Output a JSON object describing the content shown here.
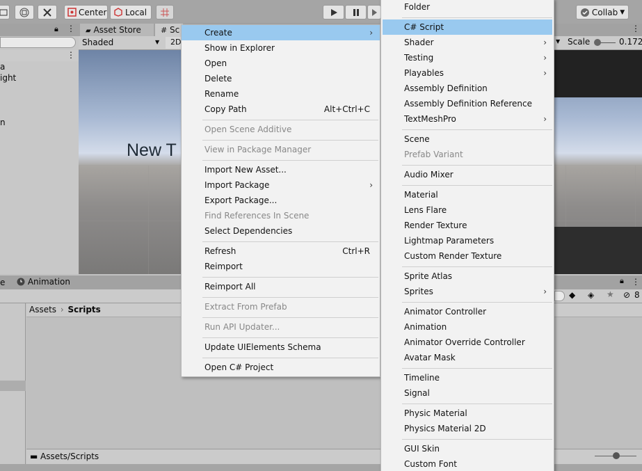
{
  "toolbar": {
    "pivot_label": "Center",
    "space_label": "Local",
    "collab_label": "Collab"
  },
  "hierarchy": {
    "partial_items": [
      "a",
      "ight",
      "n"
    ]
  },
  "tabs": {
    "asset_store": "Asset Store",
    "scene": "Sc"
  },
  "scene_toolbar": {
    "shading": "Shaded",
    "mode2d": "2D",
    "scale_label": "Scale",
    "scale_value": "0.1725"
  },
  "scene": {
    "text": "New T"
  },
  "bottom": {
    "tab_partial": "e",
    "animation_tab": "Animation",
    "hidden_count": "8"
  },
  "breadcrumb": {
    "root": "Assets",
    "current": "Scripts"
  },
  "path_bar": "Assets/Scripts",
  "context_menu": {
    "items": [
      {
        "label": "Create",
        "shortcut": "",
        "submenu": true,
        "disabled": false
      },
      {
        "label": "Show in Explorer",
        "shortcut": "",
        "submenu": false,
        "disabled": false
      },
      {
        "label": "Open",
        "shortcut": "",
        "submenu": false,
        "disabled": false
      },
      {
        "label": "Delete",
        "shortcut": "",
        "submenu": false,
        "disabled": false
      },
      {
        "label": "Rename",
        "shortcut": "",
        "submenu": false,
        "disabled": false
      },
      {
        "label": "Copy Path",
        "shortcut": "Alt+Ctrl+C",
        "submenu": false,
        "disabled": false
      },
      {
        "label": "Open Scene Additive",
        "shortcut": "",
        "submenu": false,
        "disabled": true
      },
      {
        "label": "View in Package Manager",
        "shortcut": "",
        "submenu": false,
        "disabled": true
      },
      {
        "label": "Import New Asset...",
        "shortcut": "",
        "submenu": false,
        "disabled": false
      },
      {
        "label": "Import Package",
        "shortcut": "",
        "submenu": true,
        "disabled": false
      },
      {
        "label": "Export Package...",
        "shortcut": "",
        "submenu": false,
        "disabled": false
      },
      {
        "label": "Find References In Scene",
        "shortcut": "",
        "submenu": false,
        "disabled": true
      },
      {
        "label": "Select Dependencies",
        "shortcut": "",
        "submenu": false,
        "disabled": false
      },
      {
        "label": "Refresh",
        "shortcut": "Ctrl+R",
        "submenu": false,
        "disabled": false
      },
      {
        "label": "Reimport",
        "shortcut": "",
        "submenu": false,
        "disabled": false
      },
      {
        "label": "Reimport All",
        "shortcut": "",
        "submenu": false,
        "disabled": false
      },
      {
        "label": "Extract From Prefab",
        "shortcut": "",
        "submenu": false,
        "disabled": true
      },
      {
        "label": "Run API Updater...",
        "shortcut": "",
        "submenu": false,
        "disabled": true
      },
      {
        "label": "Update UIElements Schema",
        "shortcut": "",
        "submenu": false,
        "disabled": false
      },
      {
        "label": "Open C# Project",
        "shortcut": "",
        "submenu": false,
        "disabled": false
      }
    ]
  },
  "create_menu": {
    "items": [
      {
        "label": "Folder",
        "submenu": false,
        "disabled": false
      },
      {
        "label": "C# Script",
        "submenu": false,
        "disabled": false
      },
      {
        "label": "Shader",
        "submenu": true,
        "disabled": false
      },
      {
        "label": "Testing",
        "submenu": true,
        "disabled": false
      },
      {
        "label": "Playables",
        "submenu": true,
        "disabled": false
      },
      {
        "label": "Assembly Definition",
        "submenu": false,
        "disabled": false
      },
      {
        "label": "Assembly Definition Reference",
        "submenu": false,
        "disabled": false
      },
      {
        "label": "TextMeshPro",
        "submenu": true,
        "disabled": false
      },
      {
        "label": "Scene",
        "submenu": false,
        "disabled": false
      },
      {
        "label": "Prefab Variant",
        "submenu": false,
        "disabled": true
      },
      {
        "label": "Audio Mixer",
        "submenu": false,
        "disabled": false
      },
      {
        "label": "Material",
        "submenu": false,
        "disabled": false
      },
      {
        "label": "Lens Flare",
        "submenu": false,
        "disabled": false
      },
      {
        "label": "Render Texture",
        "submenu": false,
        "disabled": false
      },
      {
        "label": "Lightmap Parameters",
        "submenu": false,
        "disabled": false
      },
      {
        "label": "Custom Render Texture",
        "submenu": false,
        "disabled": false
      },
      {
        "label": "Sprite Atlas",
        "submenu": false,
        "disabled": false
      },
      {
        "label": "Sprites",
        "submenu": true,
        "disabled": false
      },
      {
        "label": "Animator Controller",
        "submenu": false,
        "disabled": false
      },
      {
        "label": "Animation",
        "submenu": false,
        "disabled": false
      },
      {
        "label": "Animator Override Controller",
        "submenu": false,
        "disabled": false
      },
      {
        "label": "Avatar Mask",
        "submenu": false,
        "disabled": false
      },
      {
        "label": "Timeline",
        "submenu": false,
        "disabled": false
      },
      {
        "label": "Signal",
        "submenu": false,
        "disabled": false
      },
      {
        "label": "Physic Material",
        "submenu": false,
        "disabled": false
      },
      {
        "label": "Physics Material 2D",
        "submenu": false,
        "disabled": false
      },
      {
        "label": "GUI Skin",
        "submenu": false,
        "disabled": false
      },
      {
        "label": "Custom Font",
        "submenu": false,
        "disabled": false
      }
    ]
  },
  "colors": {
    "menu_highlight": "#99c9ef",
    "menu_bg": "#f2f2f2",
    "toolbar_bg": "#a5a5a5"
  }
}
